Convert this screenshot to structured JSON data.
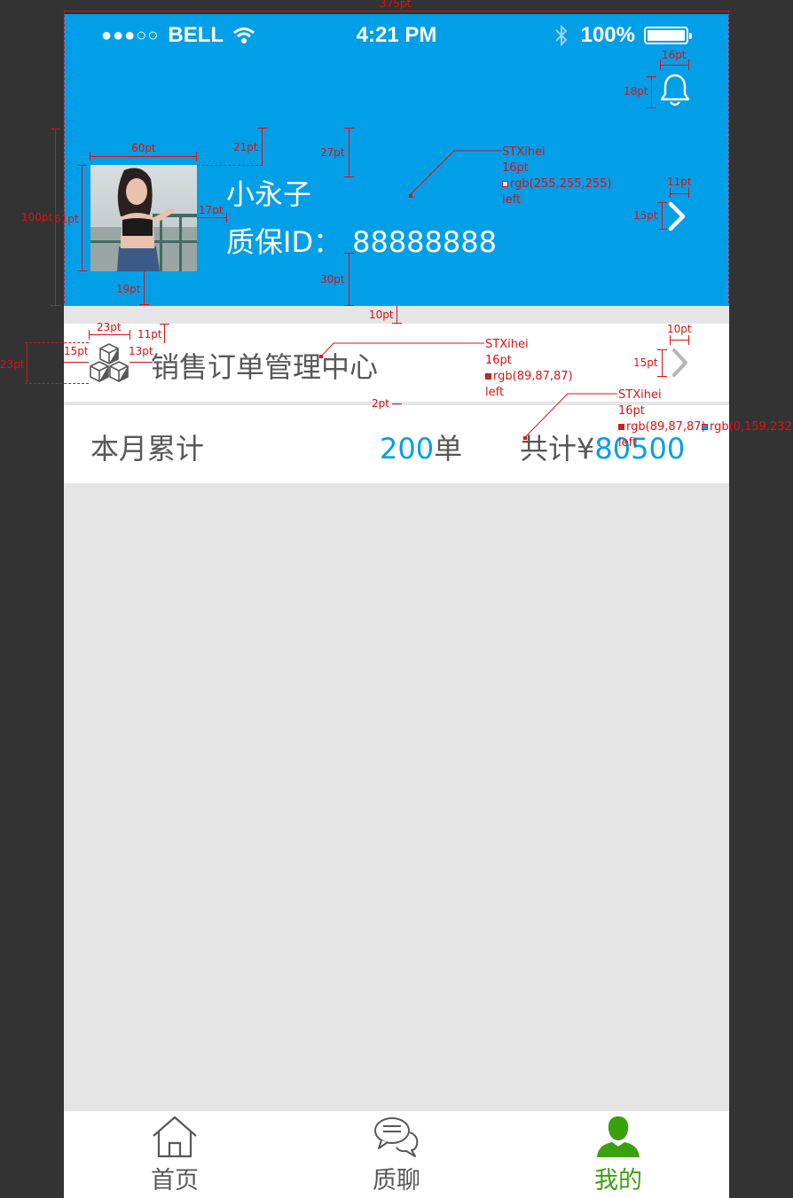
{
  "statusbar": {
    "carrier": "BELL",
    "signal_dots": "●●●○○",
    "time": "4:21 PM",
    "battery": "100%"
  },
  "profile": {
    "nickname": "小永子",
    "id_label": "质保ID：",
    "id_value": "88888888"
  },
  "order_center": {
    "label": "销售订单管理中心"
  },
  "stats": {
    "label": "本月累计",
    "count_value": "200",
    "count_unit": "单",
    "total_prefix": "共计¥",
    "total_value": "80500"
  },
  "tabs": [
    {
      "label": "首页",
      "icon": "home-icon",
      "active": false
    },
    {
      "label": "质聊",
      "icon": "chat-icon",
      "active": false
    },
    {
      "label": "我的",
      "icon": "user-icon",
      "active": true
    }
  ],
  "colors": {
    "header_blue": "#009fe8",
    "text_gray": "#595757",
    "active_green": "#3aa10e",
    "background": "#e5e5e5",
    "annotation_red": "#e01010"
  },
  "annotations": {
    "width_total": "375pt",
    "bell_w": "16pt",
    "bell_h": "18pt",
    "avatar_w": "60pt",
    "avatar_h": "61pt",
    "avatar_top": "21pt",
    "header_h": "100pt",
    "name_top": "27pt",
    "name_gap": "17pt",
    "avatar_bottom": "19pt",
    "id_bottom": "30pt",
    "chev_w": "11pt",
    "chev_h": "15pt",
    "section_gap": "10pt",
    "icon_w": "23pt",
    "icon_top": "11pt",
    "row_h": "23pt",
    "icon_left": "15pt",
    "icon_gap": "13pt",
    "order_chev_w": "10pt",
    "order_chev_h": "15pt",
    "divider": "2pt",
    "spec1": {
      "font": "STXihei",
      "size": "16pt",
      "color": "rgb(255,255,255)",
      "align": "left"
    },
    "spec2": {
      "font": "STXihei",
      "size": "16pt",
      "color": "rgb(89,87,87)",
      "align": "left"
    },
    "spec3": {
      "font": "STXihei",
      "size": "16pt",
      "color": "rgb(89,87,87)",
      "color2": "rgb(0,159,232)",
      "align": "left"
    }
  }
}
